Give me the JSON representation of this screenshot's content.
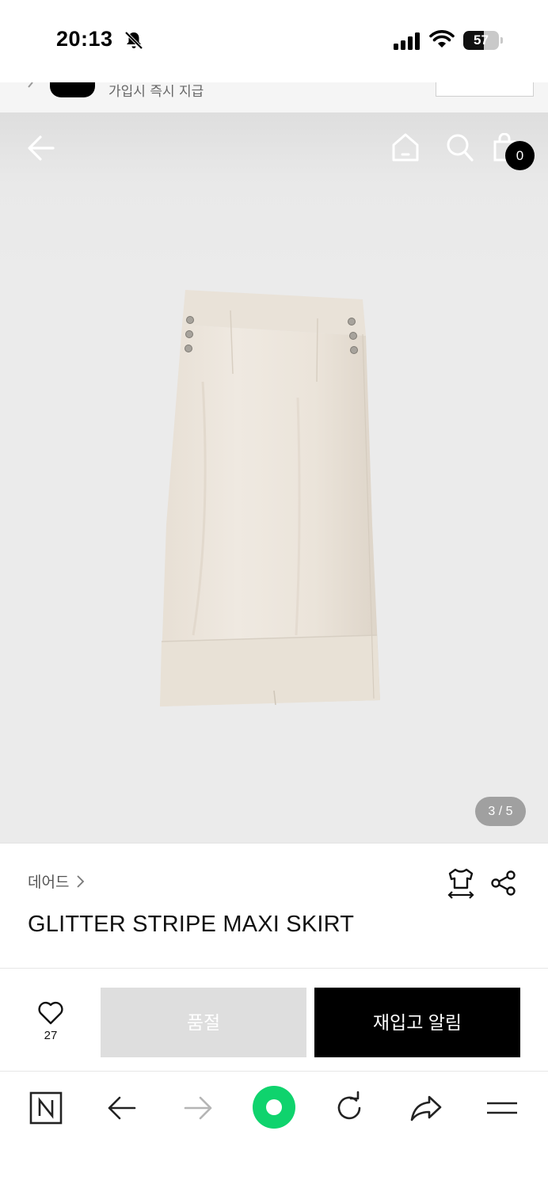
{
  "status_bar": {
    "time": "20:13",
    "battery": "57",
    "battery_fraction": 0.57,
    "icons": [
      "bell-slash-icon",
      "signal-icon",
      "wifi-icon",
      "battery-icon"
    ]
  },
  "promo": {
    "text": "가입시 즉시 지급"
  },
  "header": {
    "icons": [
      "back-arrow-icon",
      "home-icon",
      "search-icon",
      "shopping-bag-icon"
    ],
    "cart_count": "0"
  },
  "gallery": {
    "pager": "3 / 5",
    "image": "beige-maxi-skirt"
  },
  "product": {
    "brand": "데어드",
    "name": "GLITTER STRIPE MAXI SKIRT",
    "icons": [
      "size-guide-icon",
      "share-icon"
    ]
  },
  "purchase": {
    "like_count": "27",
    "soldout_label": "품절",
    "restock_label": "재입고 알림"
  },
  "browser_toolbar": {
    "icons": [
      "naver-n-icon",
      "back-arrow-icon",
      "forward-arrow-icon",
      "green-dot-icon",
      "reload-icon",
      "share-arrow-icon",
      "menu-icon"
    ]
  },
  "colors": {
    "accent_green": "#0fd36d",
    "soldout_bg": "#dedede",
    "restock_bg": "#000000",
    "hero_bg": "#ebebeb"
  }
}
